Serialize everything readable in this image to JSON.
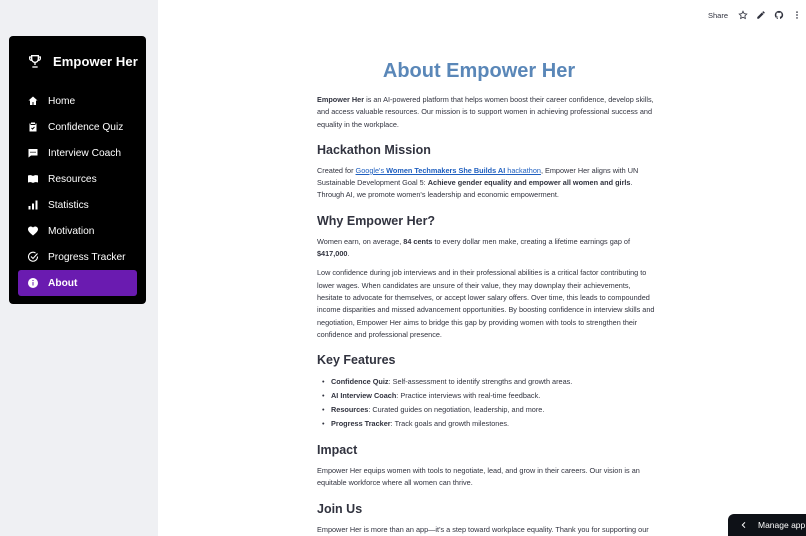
{
  "sidebar": {
    "brand": "Empower Her",
    "items": [
      {
        "label": "Home",
        "icon": "home-icon"
      },
      {
        "label": "Confidence Quiz",
        "icon": "clipboard-check-icon"
      },
      {
        "label": "Interview Coach",
        "icon": "chat-icon"
      },
      {
        "label": "Resources",
        "icon": "book-icon"
      },
      {
        "label": "Statistics",
        "icon": "bar-chart-icon"
      },
      {
        "label": "Motivation",
        "icon": "heart-icon"
      },
      {
        "label": "Progress Tracker",
        "icon": "check-circle-icon"
      },
      {
        "label": "About",
        "icon": "info-icon",
        "active": true
      }
    ],
    "active_color": "#6a1bb0"
  },
  "toolbar": {
    "share_label": "Share"
  },
  "main": {
    "title": "About Empower Her",
    "title_color": "#5a87b8",
    "intro_bold": "Empower Her",
    "intro_rest": " is an AI-powered platform that helps women boost their career confidence, develop skills, and access valuable resources. Our mission is to support women in achieving professional success and equality in the workplace.",
    "hackathon_heading": "Hackathon Mission",
    "hackathon_pre": "Created for ",
    "hackathon_link_pre": "Google's ",
    "hackathon_link_bold": "Women Techmakers She Builds AI",
    "hackathon_link_post": " hackathon",
    "hackathon_mid": ", Empower Her aligns with UN Sustainable Development Goal 5: ",
    "hackathon_goal": "Achieve gender equality and empower all women and girls",
    "hackathon_post": ". Through AI, we promote women's leadership and economic empowerment.",
    "why_heading": "Why Empower Her?",
    "why_p1_a": "Women earn, on average, ",
    "why_p1_cents": "84 cents",
    "why_p1_b": " to every dollar men make, creating a lifetime earnings gap of ",
    "why_p1_gap": "$417,000",
    "why_p1_c": ".",
    "why_p2": "Low confidence during job interviews and in their professional abilities is a critical factor contributing to lower wages. When candidates are unsure of their value, they may downplay their achievements, hesitate to advocate for themselves, or accept lower salary offers. Over time, this leads to compounded income disparities and missed advancement opportunities. By boosting confidence in interview skills and negotiation, Empower Her aims to bridge this gap by providing women with tools to strengthen their confidence and professional presence.",
    "features_heading": "Key Features",
    "features": [
      {
        "name": "Confidence Quiz",
        "desc": ": Self-assessment to identify strengths and growth areas."
      },
      {
        "name": "AI Interview Coach",
        "desc": ": Practice interviews with real-time feedback."
      },
      {
        "name": "Resources",
        "desc": ": Curated guides on negotiation, leadership, and more."
      },
      {
        "name": "Progress Tracker",
        "desc": ": Track goals and growth milestones."
      }
    ],
    "impact_heading": "Impact",
    "impact_text": "Empower Her equips women with tools to negotiate, lead, and grow in their careers. Our vision is an equitable workforce where all women can thrive.",
    "join_heading": "Join Us",
    "join_text": "Empower Her is more than an app—it's a step toward workplace equality. Thank you for supporting our mission to make a difference."
  },
  "manage_app": {
    "label": "Manage app"
  }
}
